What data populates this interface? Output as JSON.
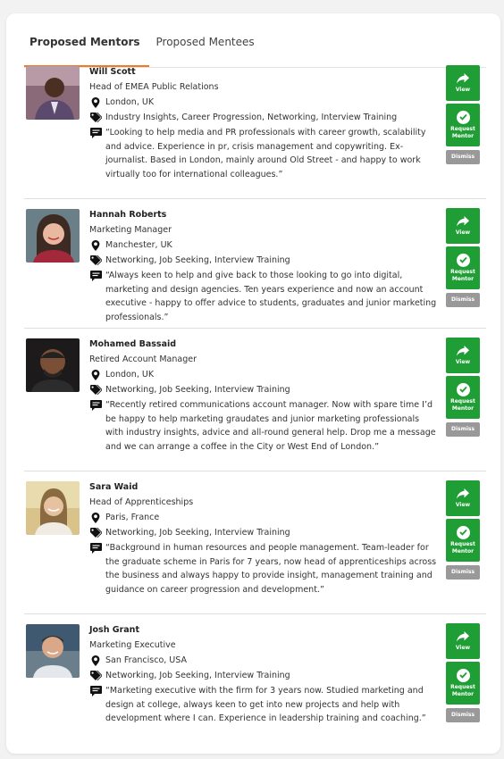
{
  "tabs": [
    {
      "label": "Proposed Mentors",
      "active": true
    },
    {
      "label": "Proposed Mentees",
      "active": false
    }
  ],
  "actions": {
    "view_label": "View",
    "request_label_line1": "Request",
    "request_label_line2": "Mentor",
    "dismiss_label": "Dismiss"
  },
  "mentors": [
    {
      "name": "Will Scott",
      "title": "Head of EMEA Public Relations",
      "location": "London, UK",
      "tags": "Industry Insights, Career Progression, Networking, Interview Training",
      "bio": "“Looking to help media and PR professionals with career growth, scalability and advice. Experience in pr, crisis management and copywriting. Ex-journalist. Based in London, mainly around Old Street - and happy to work virtually too for international colleagues.”"
    },
    {
      "name": "Hannah Roberts",
      "title": "Marketing Manager",
      "location": "Manchester, UK",
      "tags": "Networking, Job Seeking, Interview Training",
      "bio": "“Always keen to help and give back to those looking to go into digital, marketing and design agencies. Ten years experience and now an account executive - happy to offer advice to students, graduates and junior marketing professionals.”"
    },
    {
      "name": "Mohamed Bassaid",
      "title": "Retired Account Manager",
      "location": "London, UK",
      "tags": "Networking, Job Seeking, Interview Training",
      "bio": "“Recently retired communications account manager. Now with spare time I’d be happy to help marketing graudates and junior marketing professionals with industry insights, advice and all-round general help. Drop me a message and we can arrange a coffee in the City or West End of London.”"
    },
    {
      "name": "Sara Waid",
      "title": "Head of Apprenticeships",
      "location": "Paris, France",
      "tags": "Networking, Job Seeking, Interview Training",
      "bio": "“Background in human resources and people management. Team-leader for the graduate scheme in Paris for 7 years, now head of apprenticeships across the business and always happy to provide insight, management training and guidance on career progression and development.”"
    },
    {
      "name": "Josh Grant",
      "title": "Marketing Executive",
      "location": "San Francisco, USA",
      "tags": "Networking, Job Seeking, Interview Training",
      "bio": "“Marketing executive with the firm for 3 years now. Studied marketing and design at college, always keen to get into new projects and help with development where I can. Experience in leadership training and coaching.”"
    }
  ],
  "colors": {
    "accent": "#f07b24",
    "action_green": "#1f9e35",
    "dismiss_grey": "#999999"
  },
  "icons": [
    "map-pin-icon",
    "tag-icon",
    "speech-bubble-icon",
    "share-arrow-icon",
    "check-circle-icon"
  ]
}
